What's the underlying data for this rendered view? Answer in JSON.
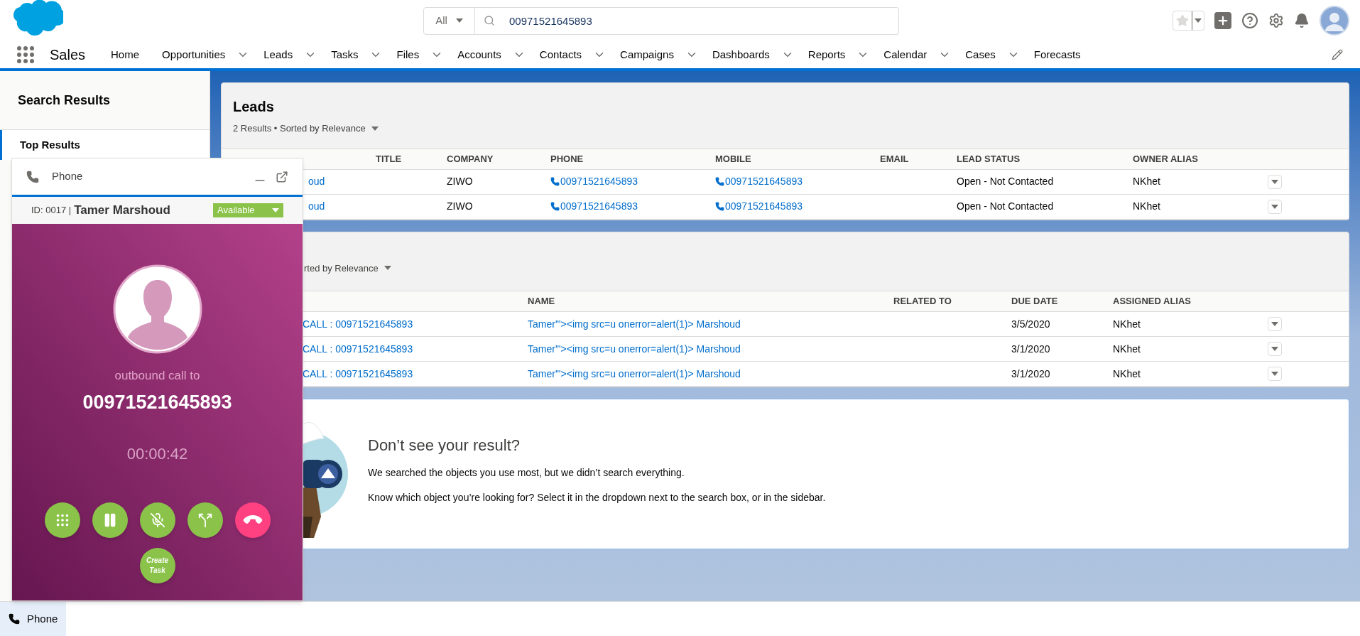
{
  "header": {
    "search": {
      "scope": "All",
      "value": "00971521645893"
    }
  },
  "nav": {
    "app_name": "Sales",
    "items": [
      {
        "label": "Home",
        "has_menu": false,
        "selected": false
      },
      {
        "label": "Opportunities",
        "has_menu": true,
        "selected": false
      },
      {
        "label": "Leads",
        "has_menu": true,
        "selected": false
      },
      {
        "label": "Tasks",
        "has_menu": true,
        "selected": false
      },
      {
        "label": "Files",
        "has_menu": true,
        "selected": false
      },
      {
        "label": "Accounts",
        "has_menu": true,
        "selected": false
      },
      {
        "label": "Contacts",
        "has_menu": true,
        "selected": false
      },
      {
        "label": "Campaigns",
        "has_menu": true,
        "selected": false
      },
      {
        "label": "Dashboards",
        "has_menu": true,
        "selected": false
      },
      {
        "label": "Reports",
        "has_menu": true,
        "selected": false
      },
      {
        "label": "Calendar",
        "has_menu": true,
        "selected": false
      },
      {
        "label": "Cases",
        "has_menu": true,
        "selected": false
      },
      {
        "label": "Forecasts",
        "has_menu": false,
        "selected": false
      }
    ]
  },
  "sidebar": {
    "title": "Search Results",
    "items": [
      {
        "label": "Top Results",
        "selected": true
      }
    ]
  },
  "leads": {
    "title": "Leads",
    "summary": "2 Results • Sorted by Relevance",
    "columns": [
      "TITLE",
      "COMPANY",
      "PHONE",
      "MOBILE",
      "EMAIL",
      "LEAD STATUS",
      "OWNER ALIAS"
    ],
    "rows": [
      {
        "name": "oud",
        "company": "ZIWO",
        "phone": "00971521645893",
        "mobile": "00971521645893",
        "lead_status": "Open - Not Contacted",
        "owner_alias": "NKhet"
      },
      {
        "name": "oud",
        "company": "ZIWO",
        "phone": "00971521645893",
        "mobile": "00971521645893",
        "lead_status": "Open - Not Contacted",
        "owner_alias": "NKhet"
      }
    ]
  },
  "tasks": {
    "summary": "rted by Relevance",
    "columns": [
      "NAME",
      "RELATED TO",
      "DUE DATE",
      "ASSIGNED ALIAS"
    ],
    "rows": [
      {
        "subject": "CALL : 00971521645893",
        "name": "Tamer'\"><img src=u onerror=alert(1)> Marshoud",
        "due_date": "3/5/2020",
        "assigned_alias": "NKhet"
      },
      {
        "subject": "CALL : 00971521645893",
        "name": "Tamer'\"><img src=u onerror=alert(1)> Marshoud",
        "due_date": "3/1/2020",
        "assigned_alias": "NKhet"
      },
      {
        "subject": "CALL : 00971521645893",
        "name": "Tamer'\"><img src=u onerror=alert(1)> Marshoud",
        "due_date": "3/1/2020",
        "assigned_alias": "NKhet"
      }
    ]
  },
  "no_result": {
    "title": "Don’t see your result?",
    "lines": [
      "We searched the objects you use most, but we didn’t search everything.",
      "Know which object you’re looking for? Select it in the dropdown next to the search box, or in the sidebar."
    ]
  },
  "phone_panel": {
    "title": "Phone",
    "agent_id": "ID: 0017 |",
    "agent_name": "Tamer Marshoud",
    "status": "Available",
    "call_label": "outbound call to",
    "number": "00971521645893",
    "timer": "00:00:42",
    "actions": [
      {
        "kind": "dialpad"
      },
      {
        "kind": "hold"
      },
      {
        "kind": "mute"
      },
      {
        "kind": "transfer"
      },
      {
        "kind": "hangup"
      }
    ],
    "create_task": "Create Task"
  },
  "utility_bar": {
    "items": [
      {
        "label": "Phone",
        "selected": true
      }
    ]
  }
}
